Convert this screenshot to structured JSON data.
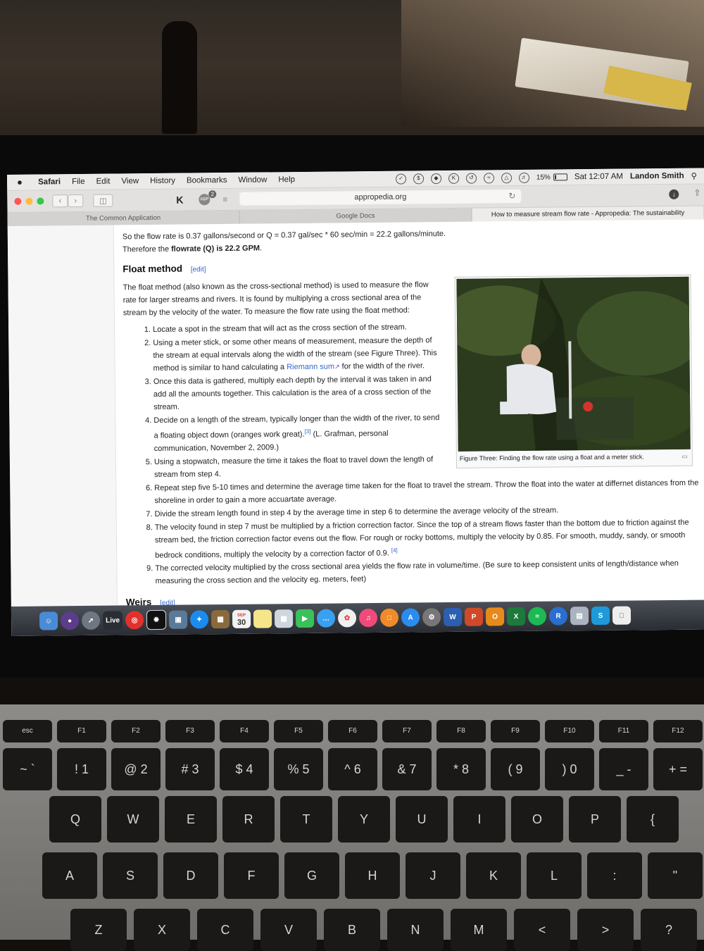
{
  "menubar": {
    "app": "Safari",
    "items": [
      "File",
      "Edit",
      "View",
      "History",
      "Bookmarks",
      "Window",
      "Help"
    ],
    "battery": "15%",
    "battery_level": 0.15,
    "clock": "Sat 12:07 AM",
    "user": "Landon Smith"
  },
  "toolbar": {
    "url": "appropedia.org",
    "abp_badge": "2"
  },
  "tabs": [
    "The Common Application",
    "Google Docs",
    "How to measure stream flow rate - Appropedia: The sustainability"
  ],
  "article": {
    "lead_text": "So the flow rate is 0.37 gallons/second or Q = 0.37 gal/sec * 60 sec/min = 22.2 gallons/minute.",
    "lead2_pre": "Therefore the ",
    "lead2_bold": "flowrate (Q) is 22.2 GPM",
    "lead2_post": ".",
    "section_title": "Float method",
    "edit_label": "[edit]",
    "intro": "The float method (also known as the cross-sectional method) is used to measure the flow rate for larger streams and rivers. It is found by multiplying a cross sectional area of the stream by the velocity of the water. To measure the flow rate using the float method:",
    "steps": [
      "Locate a spot in the stream that will act as the cross section of the stream.",
      "Using a meter stick, or some other means of measurement, measure the depth of the stream at equal intervals along the width of the stream (see Figure Three). This method is similar to hand calculating a ",
      "Once this data is gathered, multiply each depth by the interval it was taken in and add all the amounts together. This calculation is the area of a cross section of the stream.",
      "Decide on a length of the stream, typically longer than the width of the river, to send a floating object down (oranges work great).",
      "Using a stopwatch, measure the time it takes the float to travel down the length of stream from step 4.",
      "Repeat step five 5-10 times and determine the average time taken for the float to travel the stream. Throw the float into the water at differnet distances from the shoreline in order to gain a more accuartate average.",
      "Divide the stream length found in step 4 by the average time in step 6 to determine the average velocity of the stream.",
      "The velocity found in step 7 must be multiplied by a friction correction factor. Since the top of a stream flows faster than the bottom due to friction against the stream bed, the friction correction factor evens out the flow. For rough or rocky bottoms, multiply the velocity by 0.85. For smooth, muddy, sandy, or smooth bedrock conditions, multiply the velocity by a correction factor of 0.9.",
      "The corrected velocity multiplied by the cross sectional area yields the flow rate in volume/time. (Be sure to keep consistent units of length/distance when measuring the cross section and the velocity eg. meters, feet)"
    ],
    "step2_link": "Riemann sum",
    "step2_tail": " for the width of the river.",
    "step4_ref": "[3]",
    "step4_tail": " (L. Grafman, personal communication, November 2, 2009.)",
    "step8_ref": "[4]",
    "figure_caption": "Figure Three: Finding the flow rate using a float and a meter stick.",
    "next_section_title": "Weirs",
    "next_edit_label": "[edit]"
  },
  "dock": {
    "live_label": "Live",
    "calendar_day": "30",
    "calendar_month": "SEP"
  },
  "keyboard": {
    "function_row": [
      "esc",
      "F1",
      "F2",
      "F3",
      "F4",
      "F5",
      "F6",
      "F7",
      "F8",
      "F9",
      "F10",
      "F11",
      "F12"
    ],
    "number_row": [
      "~",
      "!",
      "@",
      "#",
      "$",
      "%",
      "^",
      "&",
      "*",
      "(",
      ")",
      "_",
      "+"
    ],
    "number_row_lower": [
      "`",
      "1",
      "2",
      "3",
      "4",
      "5",
      "6",
      "7",
      "8",
      "9",
      "0",
      "-",
      "="
    ],
    "qwerty_row": [
      "Q",
      "W",
      "E",
      "R",
      "T",
      "Y",
      "U",
      "I",
      "O",
      "P",
      "{"
    ],
    "home_row": [
      "A",
      "S",
      "D",
      "F",
      "G",
      "H",
      "J",
      "K",
      "L",
      ":",
      "\""
    ],
    "bottom_row": [
      "Z",
      "X",
      "C",
      "V",
      "B",
      "N",
      "M",
      "<",
      ">",
      "?"
    ]
  },
  "colors": {
    "link": "#3366cc",
    "close": "#fc5753",
    "minimize": "#fdbc40",
    "zoom": "#33c748"
  }
}
